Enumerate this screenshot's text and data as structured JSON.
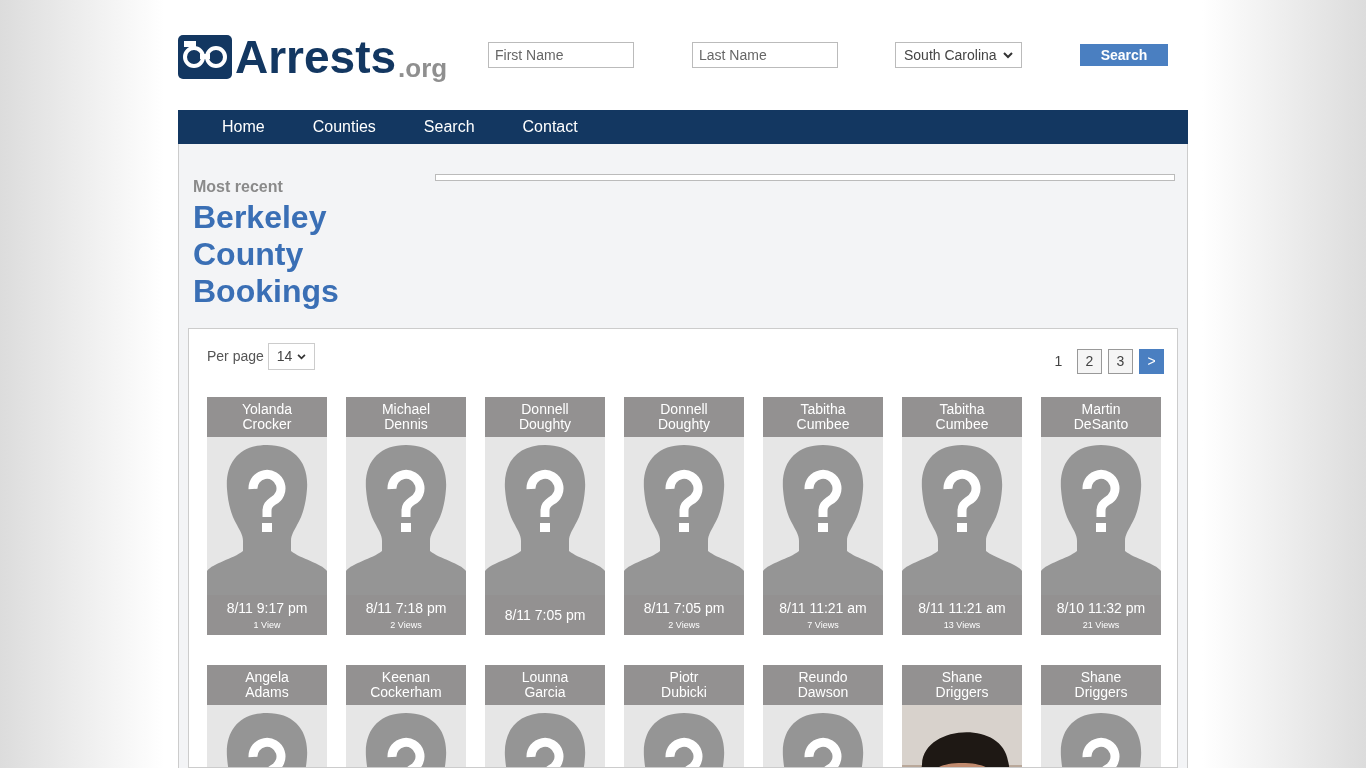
{
  "header": {
    "logo": {
      "name": "Arrests",
      "suffix": ".org"
    },
    "first_name": {
      "placeholder": "First Name"
    },
    "last_name": {
      "placeholder": "Last Name"
    },
    "state_select": {
      "value": "South Carolina"
    },
    "search_button": "Search"
  },
  "nav": [
    {
      "label": "Home"
    },
    {
      "label": "Counties"
    },
    {
      "label": "Search"
    },
    {
      "label": "Contact"
    }
  ],
  "intro": {
    "kicker": "Most recent",
    "title_lines": [
      "Berkeley",
      "County",
      "Bookings"
    ]
  },
  "listing": {
    "per_page_label": "Per page",
    "per_page": "14",
    "pagination": [
      {
        "label": "1",
        "selected": true
      },
      {
        "label": "2",
        "selected": false
      },
      {
        "label": "3",
        "selected": false
      },
      {
        "label": ">",
        "selected": false,
        "kind": "next"
      }
    ],
    "rows": [
      [
        {
          "first": "Yolanda",
          "last": "Crocker",
          "kind": "placeholder",
          "time": "8/11 9:17 pm",
          "views": "1 View"
        },
        {
          "first": "Michael",
          "last": "Dennis",
          "kind": "placeholder",
          "time": "8/11 7:18 pm",
          "views": "2 Views"
        },
        {
          "first": "Donnell",
          "last": "Doughty",
          "kind": "placeholder",
          "time": "8/11 7:05 pm"
        },
        {
          "first": "Donnell",
          "last": "Doughty",
          "kind": "placeholder",
          "time": "8/11 7:05 pm",
          "views": "2 Views"
        },
        {
          "first": "Tabitha",
          "last": "Cumbee",
          "kind": "placeholder",
          "time": "8/11 11:21 am",
          "views": "7 Views"
        },
        {
          "first": "Tabitha",
          "last": "Cumbee",
          "kind": "placeholder",
          "time": "8/11 11:21 am",
          "views": "13 Views"
        },
        {
          "first": "Martin",
          "last": "DeSanto",
          "kind": "placeholder",
          "time": "8/10 11:32 pm",
          "views": "21 Views"
        }
      ],
      [
        {
          "first": "Angela",
          "last": "Adams",
          "kind": "placeholder"
        },
        {
          "first": "Keenan",
          "last": "Cockerham",
          "kind": "placeholder"
        },
        {
          "first": "Lounna",
          "last": "Garcia",
          "kind": "placeholder"
        },
        {
          "first": "Piotr",
          "last": "Dubicki",
          "kind": "placeholder"
        },
        {
          "first": "Reundo",
          "last": "Dawson",
          "kind": "placeholder"
        },
        {
          "first": "Shane",
          "last": "Driggers",
          "kind": "picture"
        },
        {
          "first": "Shane",
          "last": "Driggers",
          "kind": "placeholder"
        }
      ]
    ]
  }
}
